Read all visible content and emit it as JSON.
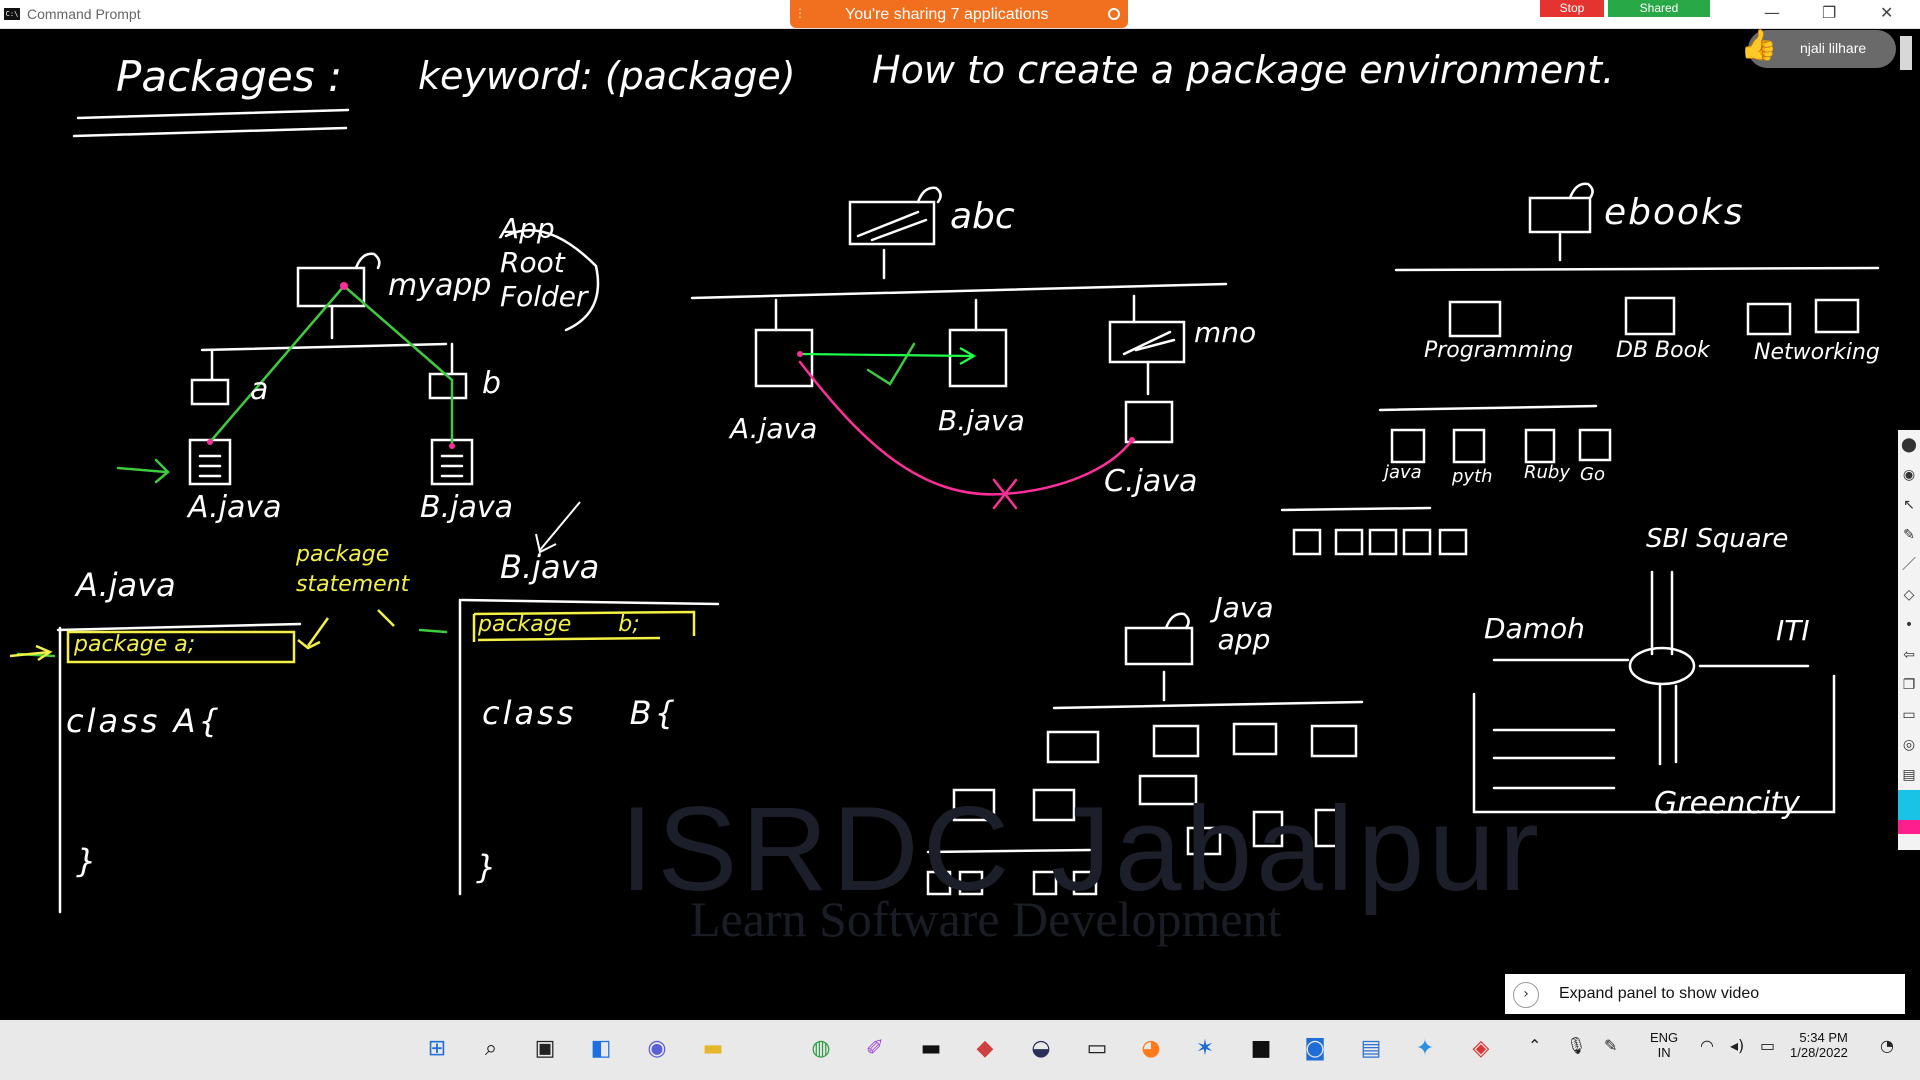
{
  "window": {
    "title": "Command Prompt",
    "app_icon": "C:\\"
  },
  "sharing": {
    "message": "You're sharing 7 applications",
    "stop": "Stop",
    "shared": "Shared"
  },
  "user": {
    "name": "njali lilhare"
  },
  "board": {
    "heading": "Packages :",
    "keyword": "keyword: (package)",
    "howto": "How to create a package environment.",
    "left_tree": {
      "root": "myapp",
      "root_note": "App Root Folder",
      "folder_a": "a",
      "folder_b": "b",
      "file_a": "A.java",
      "file_b": "B.java"
    },
    "code_a": {
      "title": "A.java",
      "package_line": "package a;",
      "class_line": "class A{",
      "close": "}"
    },
    "code_b": {
      "title": "B.java",
      "package_line": "package b;",
      "class_line": "class B{",
      "close": "}"
    },
    "package_note": "package statement",
    "abc_tree": {
      "root": "abc",
      "file_a": "A.java",
      "file_b": "B.java",
      "folder_mno": "mno",
      "file_c": "C.java"
    },
    "ebooks_tree": {
      "root": "ebooks",
      "children": [
        "Programming",
        "DB Book",
        "Networking"
      ],
      "langs": [
        "java",
        "pyth",
        "Ruby",
        "Go"
      ]
    },
    "javaapp": "Java app",
    "map": {
      "title": "SBI Square",
      "west": "Damoh",
      "east": "ITI",
      "south": "Greencity"
    }
  },
  "watermark": {
    "main": "ISRDC Jabalpur",
    "sub": "Learn Software Development"
  },
  "panel": {
    "expand_label": "Expand panel to show video"
  },
  "taskbar": {
    "lang1": "ENG",
    "lang2": "IN",
    "time": "5:34 PM",
    "date": "1/28/2022"
  }
}
